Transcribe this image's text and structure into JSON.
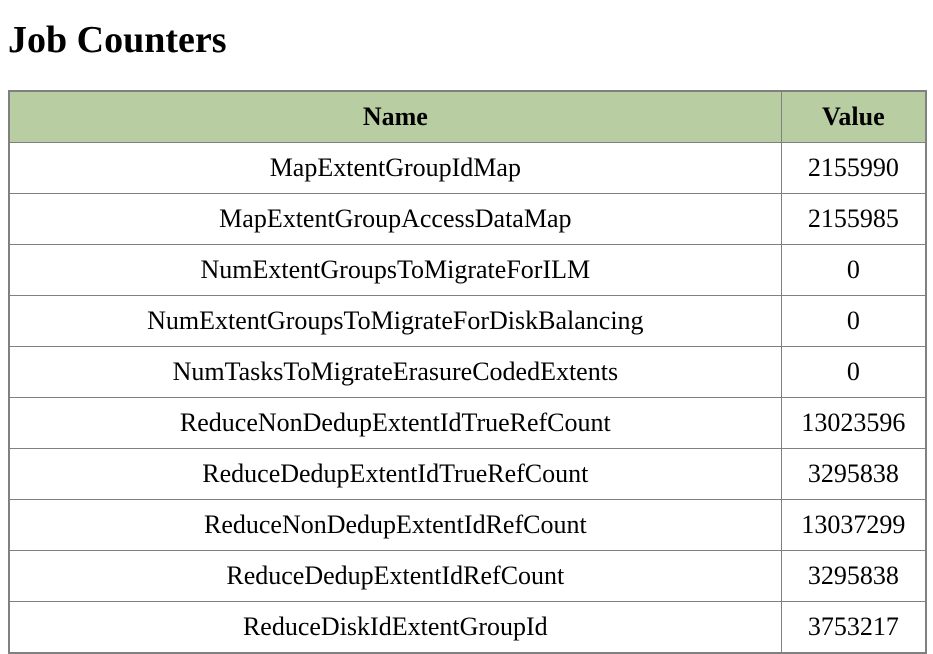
{
  "title": "Job Counters",
  "table": {
    "headers": {
      "name": "Name",
      "value": "Value"
    },
    "rows": [
      {
        "name": "MapExtentGroupIdMap",
        "value": "2155990"
      },
      {
        "name": "MapExtentGroupAccessDataMap",
        "value": "2155985"
      },
      {
        "name": "NumExtentGroupsToMigrateForILM",
        "value": "0"
      },
      {
        "name": "NumExtentGroupsToMigrateForDiskBalancing",
        "value": "0"
      },
      {
        "name": "NumTasksToMigrateErasureCodedExtents",
        "value": "0"
      },
      {
        "name": "ReduceNonDedupExtentIdTrueRefCount",
        "value": "13023596"
      },
      {
        "name": "ReduceDedupExtentIdTrueRefCount",
        "value": "3295838"
      },
      {
        "name": "ReduceNonDedupExtentIdRefCount",
        "value": "13037299"
      },
      {
        "name": "ReduceDedupExtentIdRefCount",
        "value": "3295838"
      },
      {
        "name": "ReduceDiskIdExtentGroupId",
        "value": "3753217"
      }
    ]
  }
}
